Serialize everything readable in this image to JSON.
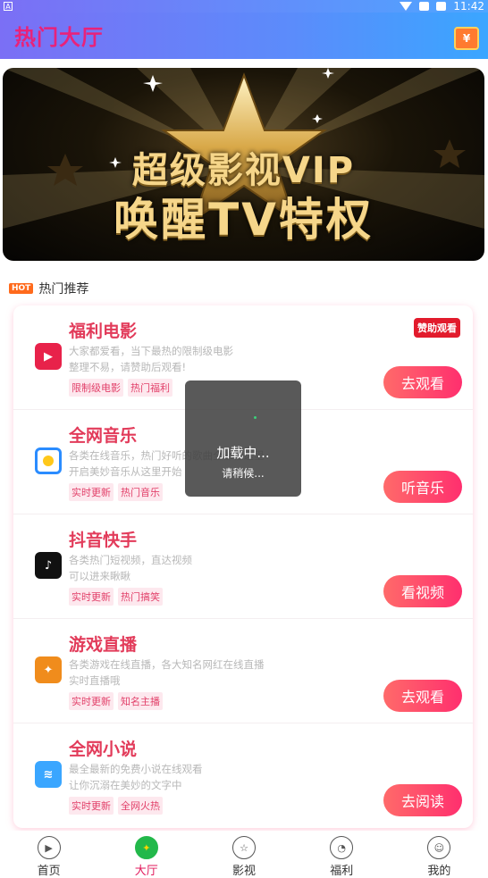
{
  "status_bar": {
    "time": "11:42"
  },
  "header": {
    "title": "热门大厅"
  },
  "banner": {
    "line1": "超级影视VIP",
    "line2": "唤醒TV特权"
  },
  "section": {
    "badge": "HOT",
    "title": "热门推荐"
  },
  "items": [
    {
      "name": "福利电影",
      "desc1": "大家都爱看，当下最热的限制级电影",
      "desc2": "整理不易，请赞助后观看!",
      "tags": [
        "限制级电影",
        "热门福利"
      ],
      "action": "去观看",
      "sponsor": "赞助观看",
      "logo_color": "#e8224a"
    },
    {
      "name": "全网音乐",
      "desc1": "各类在线音乐，热门好听的歌曲全都在这里",
      "desc2": "开启美妙音乐从这里开始",
      "tags": [
        "实时更新",
        "热门音乐"
      ],
      "action": "听音乐",
      "logo_color": "#2a8cff"
    },
    {
      "name": "抖音快手",
      "desc1": "各类热门短视频，直达视频",
      "desc2": "可以进来瞅瞅",
      "tags": [
        "实时更新",
        "热门搞笑"
      ],
      "action": "看视频",
      "logo_color": "#111111"
    },
    {
      "name": "游戏直播",
      "desc1": "各类游戏在线直播，各大知名网红在线直播",
      "desc2": "实时直播哦",
      "tags": [
        "实时更新",
        "知名主播"
      ],
      "action": "去观看",
      "logo_color": "#f08c1c"
    },
    {
      "name": "全网小说",
      "desc1": "最全最新的免费小说在线观看",
      "desc2": "让你沉溺在美妙的文字中",
      "tags": [
        "实时更新",
        "全网火热"
      ],
      "action": "去阅读",
      "logo_color": "#3aa6ff"
    }
  ],
  "loading": {
    "line1": "加载中...",
    "line2": "请稍候..."
  },
  "tabs": [
    {
      "label": "首页",
      "icon": "play-icon"
    },
    {
      "label": "大厅",
      "icon": "compass-icon",
      "active": true
    },
    {
      "label": "影视",
      "icon": "medal-icon"
    },
    {
      "label": "福利",
      "icon": "pacman-icon"
    },
    {
      "label": "我的",
      "icon": "smile-icon"
    }
  ]
}
